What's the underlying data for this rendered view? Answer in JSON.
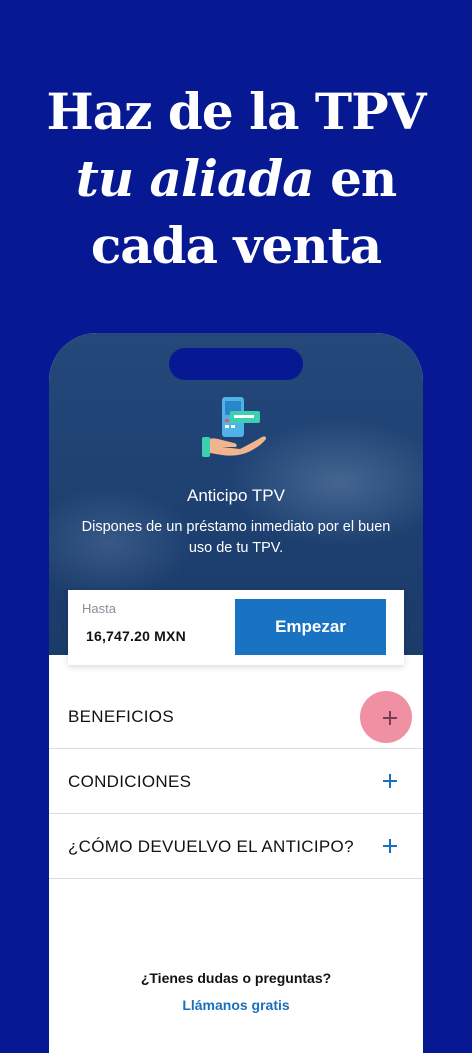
{
  "headline": {
    "line1": "Haz de la TPV",
    "line2_italic": "tu aliada",
    "line2_rest": " en",
    "line3": "cada venta"
  },
  "hero": {
    "title": "Anticipo TPV",
    "description": "Dispones de un préstamo inmediato por el buen uso de tu TPV."
  },
  "amount_card": {
    "label": "Hasta",
    "value": "16,747.20 MXN",
    "button_label": "Empezar"
  },
  "accordion": [
    {
      "label": "BENEFICIOS",
      "icon": "plus-icon"
    },
    {
      "label": "CONDICIONES",
      "icon": "plus-icon"
    },
    {
      "label": "¿CÓMO DEVUELVO EL ANTICIPO?",
      "icon": "plus-icon"
    }
  ],
  "help": {
    "question": "¿Tienes dudas o preguntas?",
    "link": "Llámanos gratis"
  },
  "colors": {
    "background": "#061892",
    "accent": "#1a73c2",
    "touch_indicator": "#e8627c"
  }
}
